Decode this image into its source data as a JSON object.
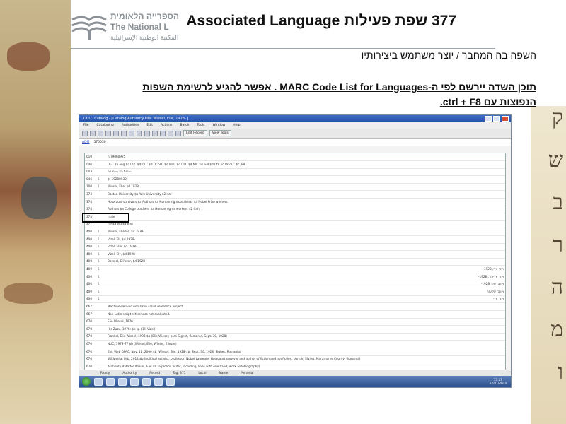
{
  "header": {
    "logo_text_line1": "הספרייה הלאומית",
    "logo_text_line2": "The National L",
    "logo_text_line3": "المكتبة الوطنية الإسرائيلية",
    "title": "377 שפת פעילות Associated Language",
    "subtitle": "השפה בה המחבר / יוצר משתמש ביצירותיו",
    "desc_line1": "תוכן השדה יירשם לפי ה-MARC Code List for Languages . אפשר להגיע לרשימת השפות",
    "desc_line2": "הנפוצות עם ctrl + F8."
  },
  "screenshot": {
    "window_title": "DCLC Catalog - [Catalog Authority File: Wiesel, Elie, 1928- ]",
    "menu": [
      "File",
      "Cataloging",
      "Authorities",
      "Edit",
      "Actions",
      "Batch",
      "Tools",
      "Window",
      "Help"
    ],
    "toolbar_labels": [
      "Edit Record",
      "View Tools"
    ],
    "record_tag": "ADM",
    "record_number": "576030",
    "rows": [
      {
        "tag": "010",
        "ind": "",
        "val": "n 79060925",
        "rtl": false
      },
      {
        "tag": "040",
        "ind": "",
        "val": "DLC $b eng $c DLC $d DLC $d OCoLC $d MnU $d DLC $d NIC $d IEN $d CtY $d OCoLC $c JPB",
        "rtl": false
      },
      {
        "tag": "043",
        "ind": "",
        "val": "n-us---- $a f-is---",
        "rtl": false
      },
      {
        "tag": "046",
        "ind": "1",
        "val": "$f 19280930",
        "rtl": false
      },
      {
        "tag": "100",
        "ind": "1",
        "val": "Wiesel, Elie, $d 1928-",
        "rtl": false
      },
      {
        "tag": "373",
        "ind": "",
        "val": "Boston University $a Yale University $2 naf",
        "rtl": false
      },
      {
        "tag": "374",
        "ind": "",
        "val": "Holocaust survivors $a Authors $a Human rights activists $a Nobel Prize winners",
        "rtl": false
      },
      {
        "tag": "374",
        "ind": "",
        "val": "Authors $a College teachers $a Human rights workers $2 lcsh",
        "rtl": false
      },
      {
        "tag": "375",
        "ind": "",
        "val": "male",
        "rtl": false
      },
      {
        "tag": "377",
        "ind": "",
        "val": "fre $a yid $a eng",
        "rtl": false
      },
      {
        "tag": "400",
        "ind": "1",
        "val": "Wiesel, Eliezer, $d 1928-",
        "rtl": false
      },
      {
        "tag": "400",
        "ind": "1",
        "val": "Vizel, Eli, $d 1928-",
        "rtl": false
      },
      {
        "tag": "400",
        "ind": "1",
        "val": "Vizel, Elie, $d 1928-",
        "rtl": false
      },
      {
        "tag": "400",
        "ind": "1",
        "val": "Vizel, Ely, $d 1928-",
        "rtl": false
      },
      {
        "tag": "400",
        "ind": "1",
        "val": "Bezelel, Eli'ezer, $d 1928-",
        "rtl": false
      },
      {
        "tag": "400",
        "ind": "1",
        "val": "ויזל, אלי, 1928-",
        "rtl": true
      },
      {
        "tag": "400",
        "ind": "1",
        "val": "ויזל, אליעזר, 1928-",
        "rtl": true
      },
      {
        "tag": "400",
        "ind": "1",
        "val": "ויזעל, אלי, 1928-",
        "rtl": true
      },
      {
        "tag": "400",
        "ind": "1",
        "val": "ויזעל, אליעזר",
        "rtl": true
      },
      {
        "tag": "400",
        "ind": "1",
        "val": "ויזל, אלי",
        "rtl": true
      },
      {
        "tag": "667",
        "ind": "",
        "val": "Machine-derived non-Latin script reference project.",
        "rtl": false
      },
      {
        "tag": "667",
        "ind": "",
        "val": "Non-Latin script references not evaluated.",
        "rtl": false
      },
      {
        "tag": "670",
        "ind": "",
        "val": "Elie Wiesel, 1976.",
        "rtl": false
      },
      {
        "tag": "670",
        "ind": "",
        "val": "His Zuzu, 1976: $b tp. (Eli Vizel)",
        "rtl": false
      },
      {
        "tag": "670",
        "ind": "",
        "val": "Frankel, Elie Wiesel, 1996 $b (Elie Wiesel; born Sighet, Romania, Sept. 30, 1928)",
        "rtl": false
      },
      {
        "tag": "670",
        "ind": "",
        "val": "NUC, 1973-77 $b (Wiesel, Elie; Wiesel, Eliezer)",
        "rtl": false
      },
      {
        "tag": "670",
        "ind": "",
        "val": "Enl. Web OPAC, Nov. 15, 2006 $b (Wiesel, Elie, 1928-; b. Sept. 30, 1928, Sighet, Romania)",
        "rtl": false
      },
      {
        "tag": "670",
        "ind": "",
        "val": "Wikipedia, Feb. 2014 $b (political activist, professor, Nobel Laureate, Holocaust survivor and author of fiction and nonfiction; born in Sighet, Maramures County, Romania)",
        "rtl": false
      },
      {
        "tag": "670",
        "ind": "",
        "val": "Authority data for Wiesel, Elie $b (a prolific writer, including, lines with one hand; work autobiography)",
        "rtl": false
      }
    ],
    "status_items": [
      "Ready",
      "Authority",
      "Record",
      "Tag: 377",
      "Local",
      "Name",
      "Personal"
    ],
    "tray_time": "13:13",
    "tray_date": "27/01/2014"
  },
  "colors": {
    "title_bar": "#2451a9",
    "highlight_border": "#000000",
    "rule": "#9aa8b2"
  },
  "icons": [
    "logo-book-icon",
    "start-orb-icon",
    "window-close-icon"
  ]
}
